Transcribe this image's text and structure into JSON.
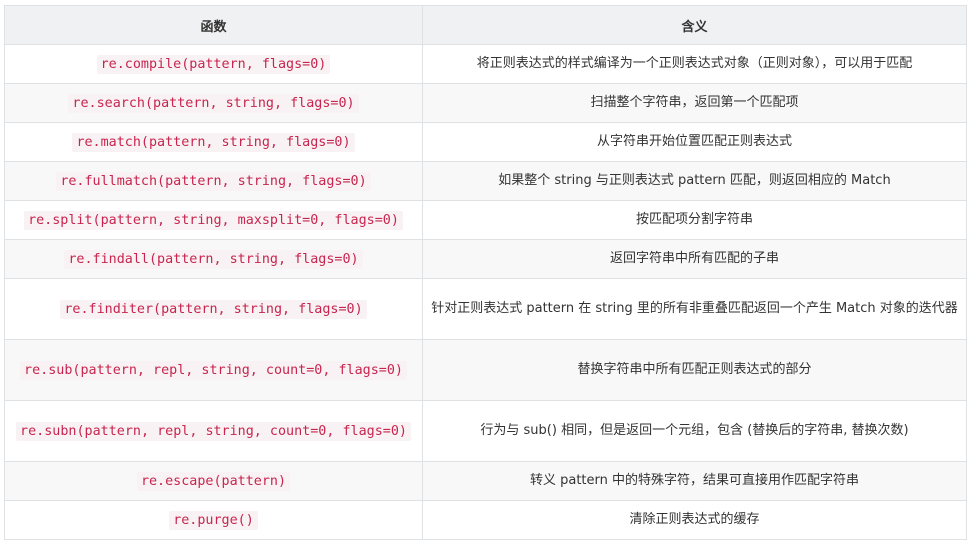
{
  "table": {
    "headers": [
      "函数",
      "含义"
    ],
    "rows": [
      {
        "func": "re.compile(pattern, flags=0)",
        "desc": "将正则表达式的样式编译为一个正则表达式对象（正则对象），可以用于匹配"
      },
      {
        "func": "re.search(pattern, string, flags=0)",
        "desc": "扫描整个字符串，返回第一个匹配项"
      },
      {
        "func": "re.match(pattern, string, flags=0)",
        "desc": "从字符串开始位置匹配正则表达式"
      },
      {
        "func": "re.fullmatch(pattern, string, flags=0)",
        "desc": "如果整个 string 与正则表达式 pattern 匹配，则返回相应的 Match"
      },
      {
        "func": "re.split(pattern, string, maxsplit=0, flags=0)",
        "desc": "按匹配项分割字符串"
      },
      {
        "func": "re.findall(pattern, string, flags=0)",
        "desc": "返回字符串中所有匹配的子串"
      },
      {
        "func": "re.finditer(pattern, string, flags=0)",
        "desc": "针对正则表达式 pattern 在 string 里的所有非重叠匹配返回一个产生 Match 对象的迭代器"
      },
      {
        "func": "re.sub(pattern, repl, string, count=0, flags=0)",
        "desc": "替换字符串中所有匹配正则表达式的部分"
      },
      {
        "func": "re.subn(pattern, repl, string, count=0, flags=0)",
        "desc": "行为与 sub() 相同，但是返回一个元组，包含 (替换后的字符串, 替换次数)"
      },
      {
        "func": "re.escape(pattern)",
        "desc": "转义 pattern 中的特殊字符，结果可直接用作匹配字符串"
      },
      {
        "func": "re.purge()",
        "desc": "清除正则表达式的缓存"
      }
    ]
  }
}
